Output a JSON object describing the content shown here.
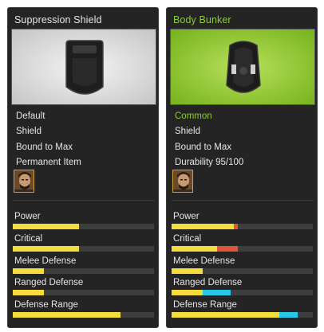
{
  "colors": {
    "yellow": "#f4dc3c",
    "red": "#e0553a",
    "cyan": "#29c7e6",
    "green_text": "#8fc93a",
    "track": "#3e3e3e"
  },
  "cards": [
    {
      "title": "Suppression Shield",
      "title_color": "#e6e6e6",
      "image": "suppression-shield-icon",
      "preview_bg": "gray",
      "info": [
        {
          "text": "Default",
          "color": "#e6e6e6"
        },
        {
          "text": "Shield",
          "color": "#e6e6e6"
        },
        {
          "text": "Bound to Max",
          "color": "#e6e6e6"
        },
        {
          "text": "Permanent Item",
          "color": "#e6e6e6"
        }
      ],
      "portrait": "character-portrait",
      "stats": [
        {
          "label": "Power",
          "segments": [
            {
              "value": 0.47,
              "color": "#f4dc3c"
            }
          ]
        },
        {
          "label": "Critical",
          "segments": [
            {
              "value": 0.47,
              "color": "#f4dc3c"
            }
          ]
        },
        {
          "label": "Melee Defense",
          "segments": [
            {
              "value": 0.22,
              "color": "#f4dc3c"
            }
          ]
        },
        {
          "label": "Ranged Defense",
          "segments": [
            {
              "value": 0.22,
              "color": "#f4dc3c"
            }
          ]
        },
        {
          "label": "Defense Range",
          "segments": [
            {
              "value": 0.76,
              "color": "#f4dc3c"
            }
          ]
        }
      ]
    },
    {
      "title": "Body Bunker",
      "title_color": "#8fc93a",
      "image": "body-bunker-icon",
      "preview_bg": "green",
      "info": [
        {
          "text": "Common",
          "color": "#8fc93a"
        },
        {
          "text": "Shield",
          "color": "#e6e6e6"
        },
        {
          "text": "Bound to Max",
          "color": "#e6e6e6"
        },
        {
          "text": "Durability 95/100",
          "color": "#e6e6e6"
        }
      ],
      "portrait": "character-portrait",
      "stats": [
        {
          "label": "Power",
          "segments": [
            {
              "value": 0.44,
              "color": "#f4dc3c"
            },
            {
              "value": 0.03,
              "color": "#e0553a"
            }
          ]
        },
        {
          "label": "Critical",
          "segments": [
            {
              "value": 0.32,
              "color": "#f4dc3c"
            },
            {
              "value": 0.15,
              "color": "#e0553a"
            }
          ]
        },
        {
          "label": "Melee Defense",
          "segments": [
            {
              "value": 0.22,
              "color": "#f4dc3c"
            }
          ]
        },
        {
          "label": "Ranged Defense",
          "segments": [
            {
              "value": 0.22,
              "color": "#f4dc3c"
            },
            {
              "value": 0.2,
              "color": "#29c7e6"
            }
          ]
        },
        {
          "label": "Defense Range",
          "segments": [
            {
              "value": 0.76,
              "color": "#f4dc3c"
            },
            {
              "value": 0.13,
              "color": "#29c7e6"
            }
          ]
        }
      ]
    }
  ]
}
